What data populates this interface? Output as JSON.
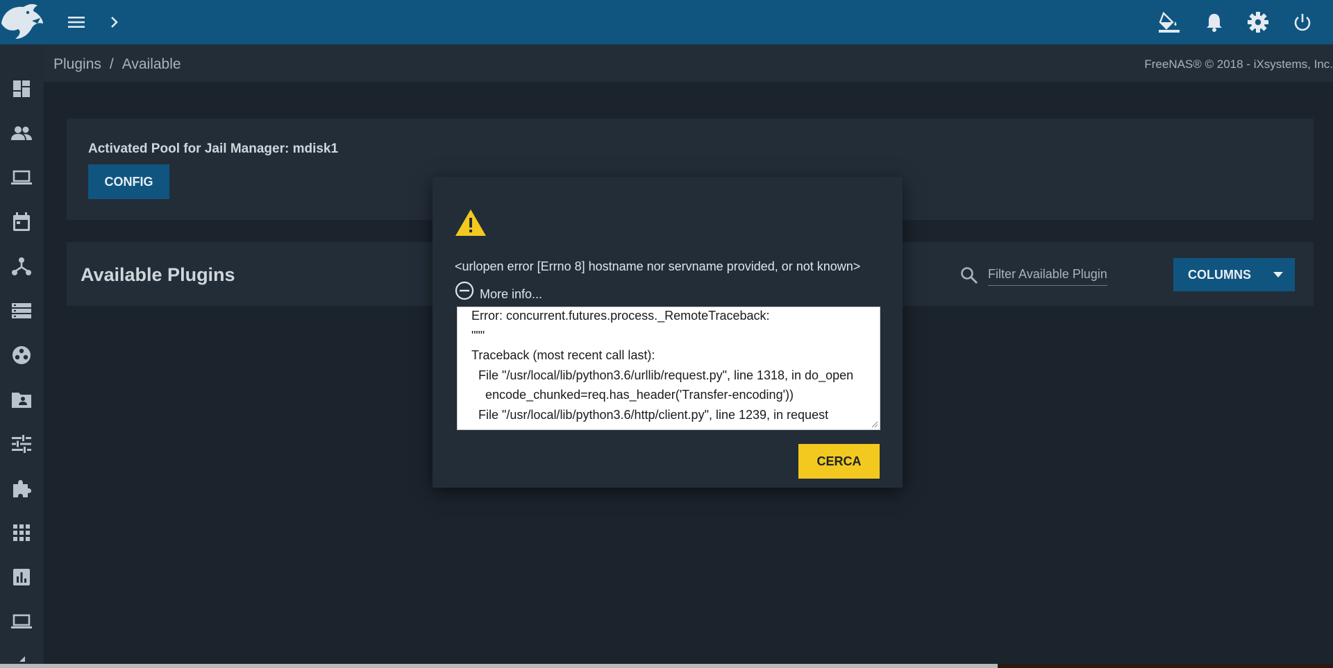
{
  "header": {
    "icons": [
      "logo",
      "menu-icon",
      "chevron-right-icon",
      "theme-icon",
      "bell-icon",
      "gear-icon",
      "power-icon"
    ]
  },
  "breadcrumb": {
    "parent": "Plugins",
    "separator": "/",
    "current": "Available"
  },
  "copyright": "FreeNAS® © 2018 - iXsystems, Inc.",
  "sidebar": {
    "items": [
      "dashboard-icon",
      "accounts-icon",
      "system-icon",
      "tasks-icon",
      "network-icon",
      "storage-icon",
      "directory-services-icon",
      "sharing-icon",
      "services-icon",
      "plugins-icon",
      "jails-icon",
      "reporting-icon",
      "virtual-machines-icon"
    ]
  },
  "jail_card": {
    "title": "Activated Pool for Jail Manager: mdisk1",
    "config_label": "CONFIG"
  },
  "plugins_card": {
    "title": "Available Plugins",
    "search_placeholder": "Filter Available Plugins",
    "columns_label": "COLUMNS"
  },
  "dialog": {
    "message": "<urlopen error [Errno 8] hostname nor servname provided, or not known>",
    "more_info_label": "More info...",
    "traceback": "Error: concurrent.futures.process._RemoteTraceback:\n\"\"\"\nTraceback (most recent call last):\n  File \"/usr/local/lib/python3.6/urllib/request.py\", line 1318, in do_open\n    encode_chunked=req.has_header('Transfer-encoding'))\n  File \"/usr/local/lib/python3.6/http/client.py\", line 1239, in request",
    "close_label": "CERCA"
  },
  "colors": {
    "topbar": "#0f5580",
    "background": "#1b232c",
    "card": "#232d38",
    "accent": "#f3c91f",
    "warning": "#f3c91f"
  }
}
